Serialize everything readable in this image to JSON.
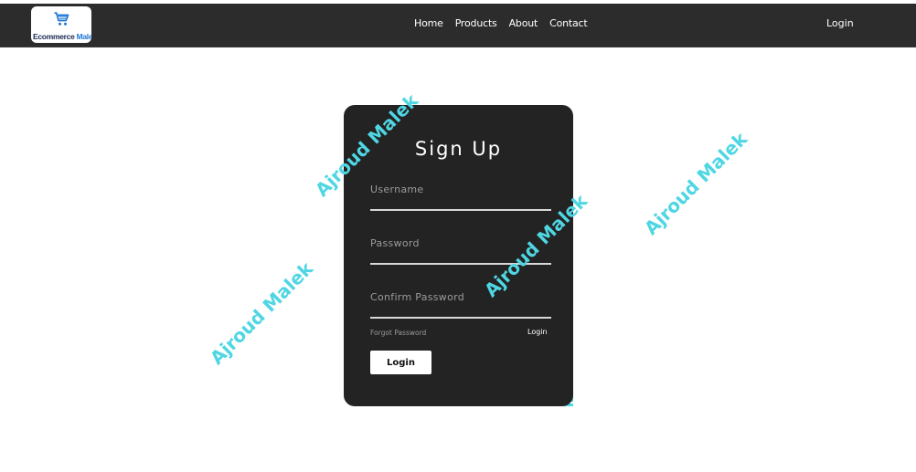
{
  "logo": {
    "word1": "Ecommerce",
    "word2": "Malek",
    "icon": "shopping-cart-icon"
  },
  "nav": {
    "links": [
      "Home",
      "Products",
      "About",
      "Contact"
    ],
    "login": "Login"
  },
  "form": {
    "title": "Sign Up",
    "fields": [
      {
        "label": "Username",
        "value": ""
      },
      {
        "label": "Password",
        "value": ""
      },
      {
        "label": "Confirm Password",
        "value": ""
      }
    ],
    "forgot": "Forgot Password",
    "login_link": "Login",
    "submit": "Login"
  },
  "watermarks": [
    "Ajroud Malek",
    "Ajroud Malek",
    "Ajroud Malek",
    "Ajroud Malek"
  ],
  "colors": {
    "navbar": "#2c2c2c",
    "card": "#232323",
    "accent_cyan": "#4fd6e3",
    "accent_pink": "#e0245e",
    "watermark": "#4fd6e3"
  }
}
